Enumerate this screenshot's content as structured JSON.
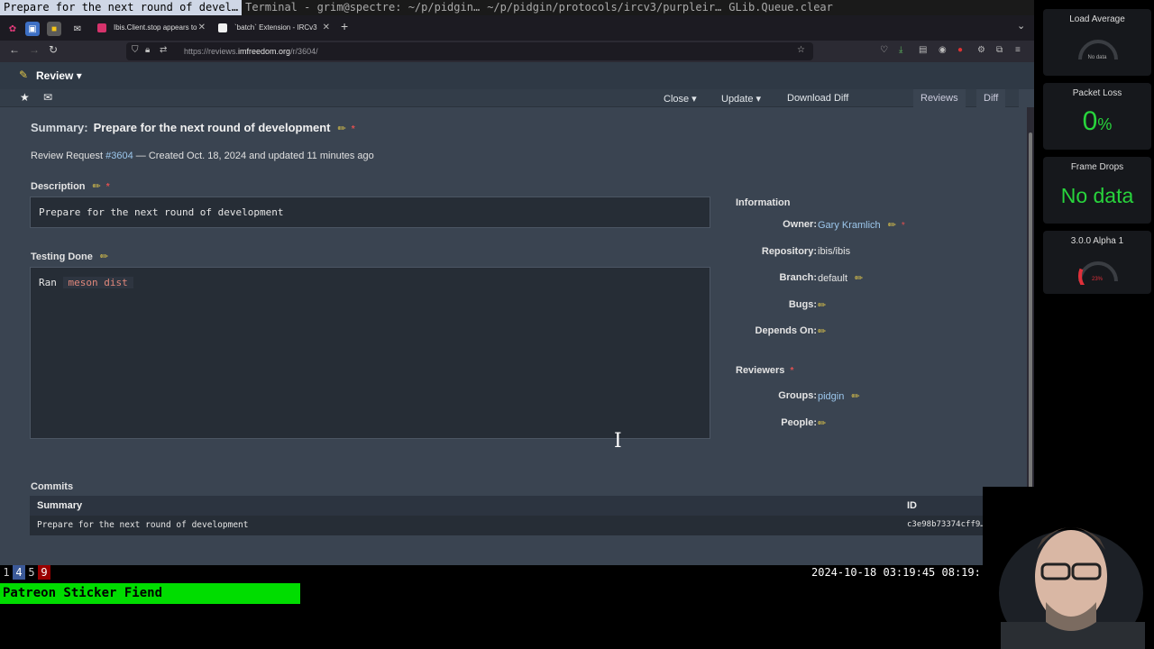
{
  "window_bar": {
    "titles": [
      "Prepare for the next round of devel…",
      "Terminal - grim@spectre: ~/p/pidgin…",
      "~/p/pidgin/protocols/ircv3/purpleir…",
      "GLib.Queue.clear"
    ]
  },
  "tabs": [
    {
      "label": "Ibis.Client.stop appears to"
    },
    {
      "label": "`batch` Extension - IRCv3"
    }
  ],
  "url": {
    "prefix": "https://reviews.",
    "domain": "imfreedom.org",
    "path": "/r/3604/"
  },
  "app": {
    "nav_title": "Review"
  },
  "review_bar": {
    "close": "Close ▾",
    "update": "Update ▾",
    "download_diff": "Download Diff",
    "tab_reviews": "Reviews",
    "tab_diff": "Diff"
  },
  "request": {
    "summary_label": "Summary:",
    "summary": "Prepare for the next round of development",
    "meta_prefix": "Review Request ",
    "meta_id": "#3604",
    "meta_suffix": " — Created Oct. 18, 2024 and updated 11 minutes ago",
    "description_label": "Description",
    "description": "Prepare for the next round of development",
    "testing_label": "Testing Done",
    "testing_prefix": "Ran",
    "testing_code": "meson dist"
  },
  "information": {
    "heading": "Information",
    "owner_label": "Owner:",
    "owner": "Gary Kramlich",
    "repository_label": "Repository:",
    "repository": "ibis/ibis",
    "branch_label": "Branch:",
    "branch": "default",
    "bugs_label": "Bugs:",
    "depends_label": "Depends On:"
  },
  "reviewers": {
    "heading": "Reviewers",
    "groups_label": "Groups:",
    "groups": "pidgin",
    "people_label": "People:"
  },
  "commits": {
    "label": "Commits",
    "col_summary": "Summary",
    "col_id": "ID",
    "rows": [
      {
        "summary": "Prepare for the next round of development",
        "id": "c3e98b73374cff9…"
      }
    ]
  },
  "tmux": {
    "workspaces": [
      "1",
      "4",
      "5",
      "9"
    ],
    "clock": "2024-10-18 03:19:45 08:19:"
  },
  "banner": "Patreon Sticker Fiend",
  "stats": {
    "load_title": "Load Average",
    "load_value": "No data",
    "packet_title": "Packet Loss",
    "packet_value": "0",
    "packet_unit": "%",
    "frames_title": "Frame Drops",
    "frames_value": "No data",
    "alpha_title": "3.0.0 Alpha 1",
    "alpha_value": "23%",
    "alpha_fraction": 0.23
  },
  "colors": {
    "accent_green": "#28d43c",
    "link_blue": "#9cc7ec",
    "pencil_yellow": "#e3c84a",
    "gauge_red": "#e0303a"
  }
}
